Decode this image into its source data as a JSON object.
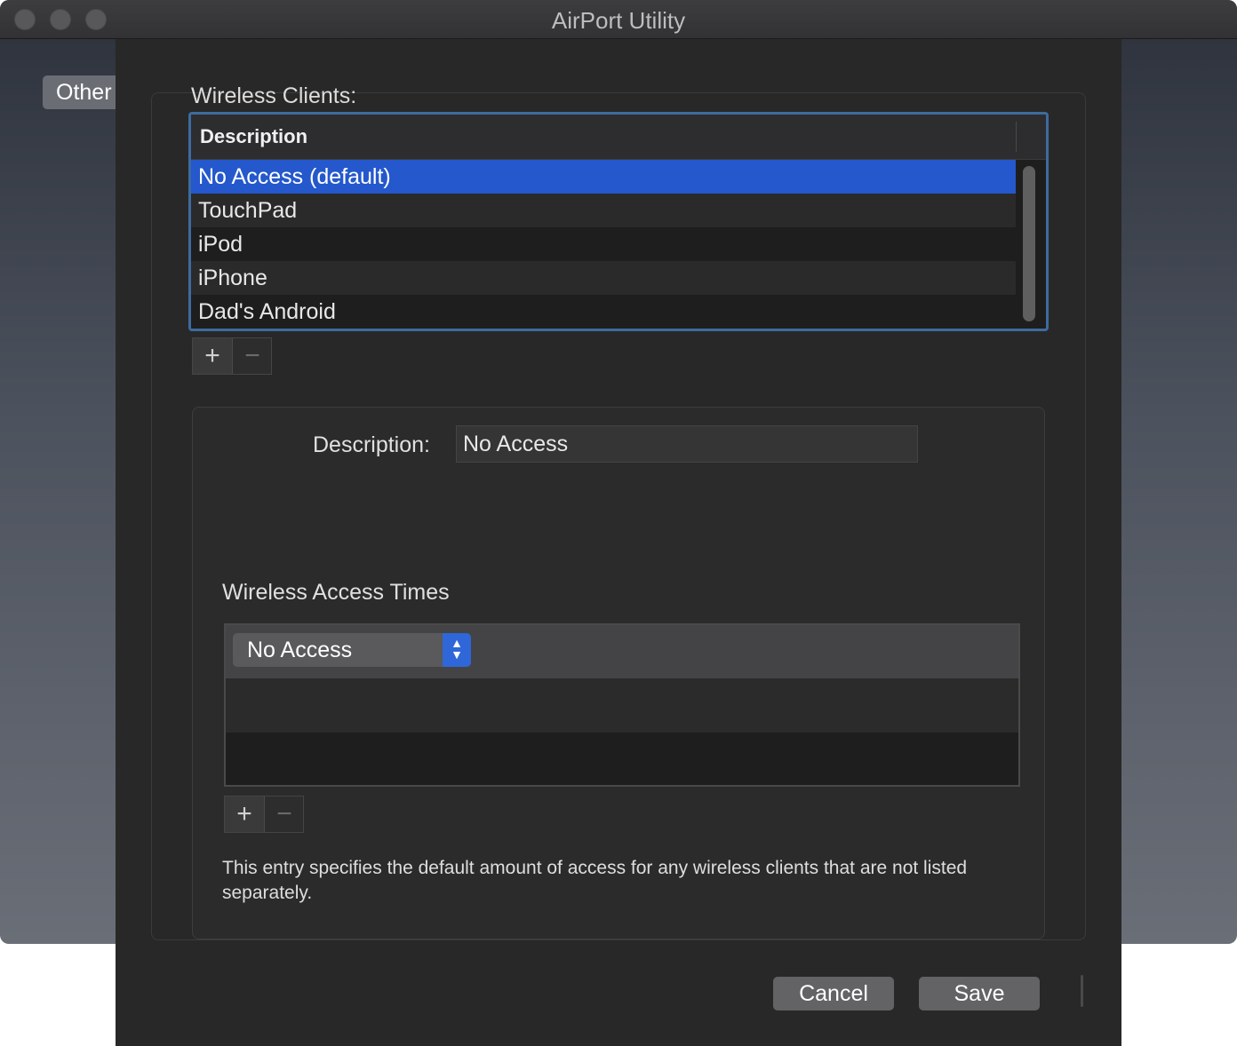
{
  "window": {
    "title": "AirPort Utility"
  },
  "background": {
    "other_button": "Other"
  },
  "wireless_clients": {
    "label": "Wireless Clients:",
    "column_header": "Description",
    "rows": [
      "No Access (default)",
      "TouchPad",
      "iPod",
      "iPhone",
      "Dad's Android"
    ],
    "selected": "No Access (default)",
    "add_label": "+",
    "remove_label": "−"
  },
  "detail": {
    "description_label": "Description:",
    "description_value": "No Access",
    "access_times_label": "Wireless Access Times",
    "access_popup_value": "No Access",
    "popup_arrows": "⌃⌄",
    "add_label": "+",
    "remove_label": "−",
    "info_text": "This entry specifies the default amount of access for any wireless clients that are not listed separately."
  },
  "buttons": {
    "cancel": "Cancel",
    "save": "Save"
  },
  "colors": {
    "selection": "#2458cc",
    "focus_ring": "#3e6b9f",
    "popup_accent": "#2f67d8"
  }
}
